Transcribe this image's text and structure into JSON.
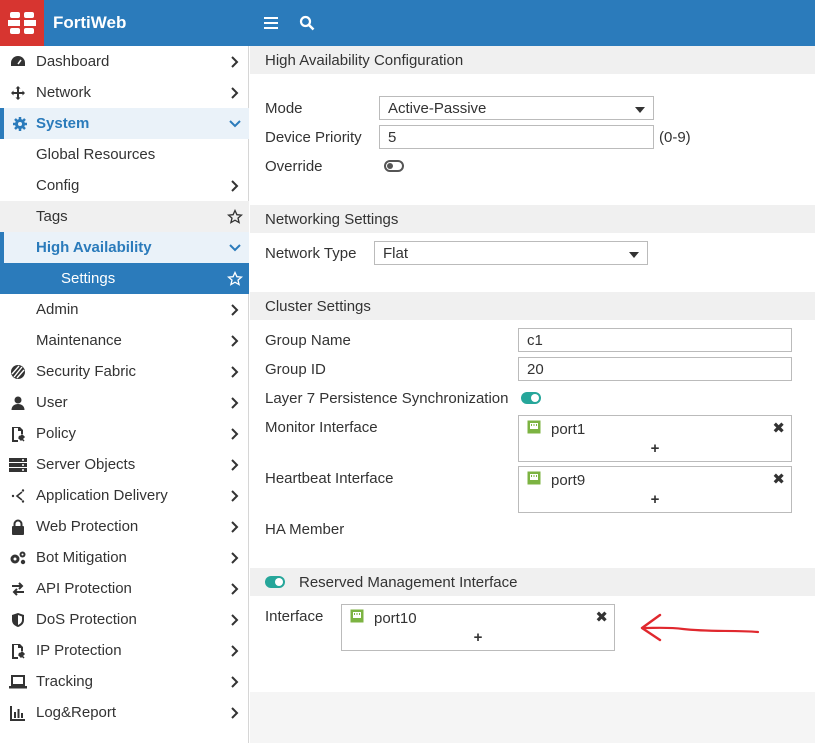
{
  "app": {
    "name": "FortiWeb"
  },
  "sidebar": {
    "items": [
      {
        "label": "Dashboard",
        "icon": "dashboard-icon",
        "chevron": "right"
      },
      {
        "label": "Network",
        "icon": "network-icon",
        "chevron": "right"
      },
      {
        "label": "System",
        "icon": "gear-icon",
        "chevron": "down"
      },
      {
        "label": "Global Resources"
      },
      {
        "label": "Config",
        "chevron": "right"
      },
      {
        "label": "Tags",
        "star": true
      },
      {
        "label": "High Availability",
        "chevron": "down"
      },
      {
        "label": "Settings",
        "star": true
      },
      {
        "label": "Admin",
        "chevron": "right"
      },
      {
        "label": "Maintenance",
        "chevron": "right"
      },
      {
        "label": "Security Fabric",
        "icon": "security-fabric-icon",
        "chevron": "right"
      },
      {
        "label": "User",
        "icon": "user-icon",
        "chevron": "right"
      },
      {
        "label": "Policy",
        "icon": "policy-icon",
        "chevron": "right"
      },
      {
        "label": "Server Objects",
        "icon": "server-icon",
        "chevron": "right"
      },
      {
        "label": "Application Delivery",
        "icon": "app-delivery-icon",
        "chevron": "right"
      },
      {
        "label": "Web Protection",
        "icon": "lock-icon",
        "chevron": "right"
      },
      {
        "label": "Bot Mitigation",
        "icon": "bot-icon",
        "chevron": "right"
      },
      {
        "label": "API Protection",
        "icon": "api-icon",
        "chevron": "right"
      },
      {
        "label": "DoS Protection",
        "icon": "shield-icon",
        "chevron": "right"
      },
      {
        "label": "IP Protection",
        "icon": "ip-icon",
        "chevron": "right"
      },
      {
        "label": "Tracking",
        "icon": "laptop-icon",
        "chevron": "right"
      },
      {
        "label": "Log&Report",
        "icon": "chart-icon",
        "chevron": "right"
      }
    ]
  },
  "ha_config": {
    "title": "High Availability Configuration",
    "mode_label": "Mode",
    "mode_value": "Active-Passive",
    "priority_label": "Device Priority",
    "priority_value": "5",
    "priority_range": "(0-9)",
    "override_label": "Override",
    "override_on": false
  },
  "networking": {
    "title": "Networking Settings",
    "type_label": "Network Type",
    "type_value": "Flat"
  },
  "cluster": {
    "title": "Cluster Settings",
    "group_name_label": "Group Name",
    "group_name_value": "c1",
    "group_id_label": "Group ID",
    "group_id_value": "20",
    "l7_label": "Layer 7 Persistence Synchronization",
    "l7_on": true,
    "monitor_label": "Monitor Interface",
    "monitor_port": "port1",
    "heartbeat_label": "Heartbeat Interface",
    "heartbeat_port": "port9",
    "ha_member_label": "HA Member"
  },
  "reserved": {
    "title": "Reserved Management Interface",
    "on": true,
    "interface_label": "Interface",
    "interface_port": "port10"
  },
  "symbols": {
    "plus": "+",
    "remove": "✖"
  },
  "colors": {
    "brand": "#2b7bbb",
    "logo": "#d73530",
    "toggle_on": "#26a69a",
    "port_icon": "#7cb342",
    "annotation": "#e0282e"
  }
}
